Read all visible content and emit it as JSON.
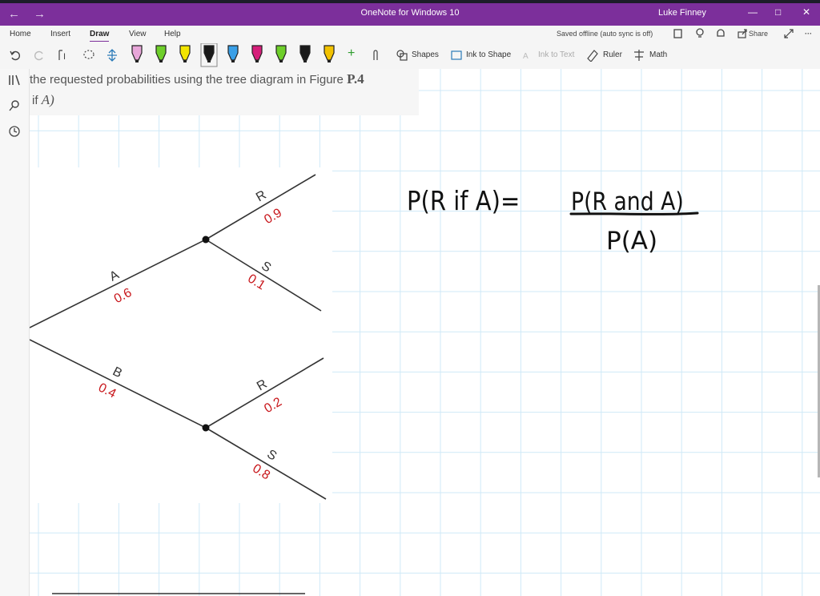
{
  "titlebar": {
    "app_title": "OneNote for Windows 10",
    "user": "Luke Finney",
    "back": "←",
    "forward": "→",
    "minimize": "—",
    "restore": "□",
    "close": "✕"
  },
  "tabs": [
    "Home",
    "Insert",
    "Draw",
    "View",
    "Help"
  ],
  "status": {
    "saved": "Saved offline (auto sync is off)",
    "share": "Share",
    "more": "···"
  },
  "toolbar": {
    "shapes": "Shapes",
    "ink_to_shape": "Ink to Shape",
    "ink_to_text": "Ink to Text",
    "ruler": "Ruler",
    "math": "Math",
    "add": "+"
  },
  "pen_colors": [
    "#e8a6d9",
    "#6ecf2a",
    "#f2e500",
    "#1a1a1a",
    "#3aa0e8",
    "#d61e7a",
    "#6ecf2a",
    "#1a1a1a",
    "#f2c200"
  ],
  "colors": {
    "accent": "#7c2f9b",
    "grid": "#cfe9f7",
    "tree_label_red": "#c8161b"
  },
  "question": {
    "line1": "the requested probabilities using the tree diagram in Figure ",
    "line1_bold": "P.4",
    "line2_prefix": "' if ",
    "line2_var": "A)"
  },
  "tree": {
    "branch_a": "A",
    "branch_a_prob": "0.6",
    "branch_b": "B",
    "branch_b_prob": "0.4",
    "a_r": "R",
    "a_r_prob": "0.9",
    "a_s": "S",
    "a_s_prob": "0.1",
    "b_r": "R",
    "b_r_prob": "0.2",
    "b_s": "S",
    "b_s_prob": "0.8"
  },
  "handwriting": {
    "lhs": "P(R if A)=",
    "numerator": "P(R and A)",
    "denominator": "P(A)"
  }
}
